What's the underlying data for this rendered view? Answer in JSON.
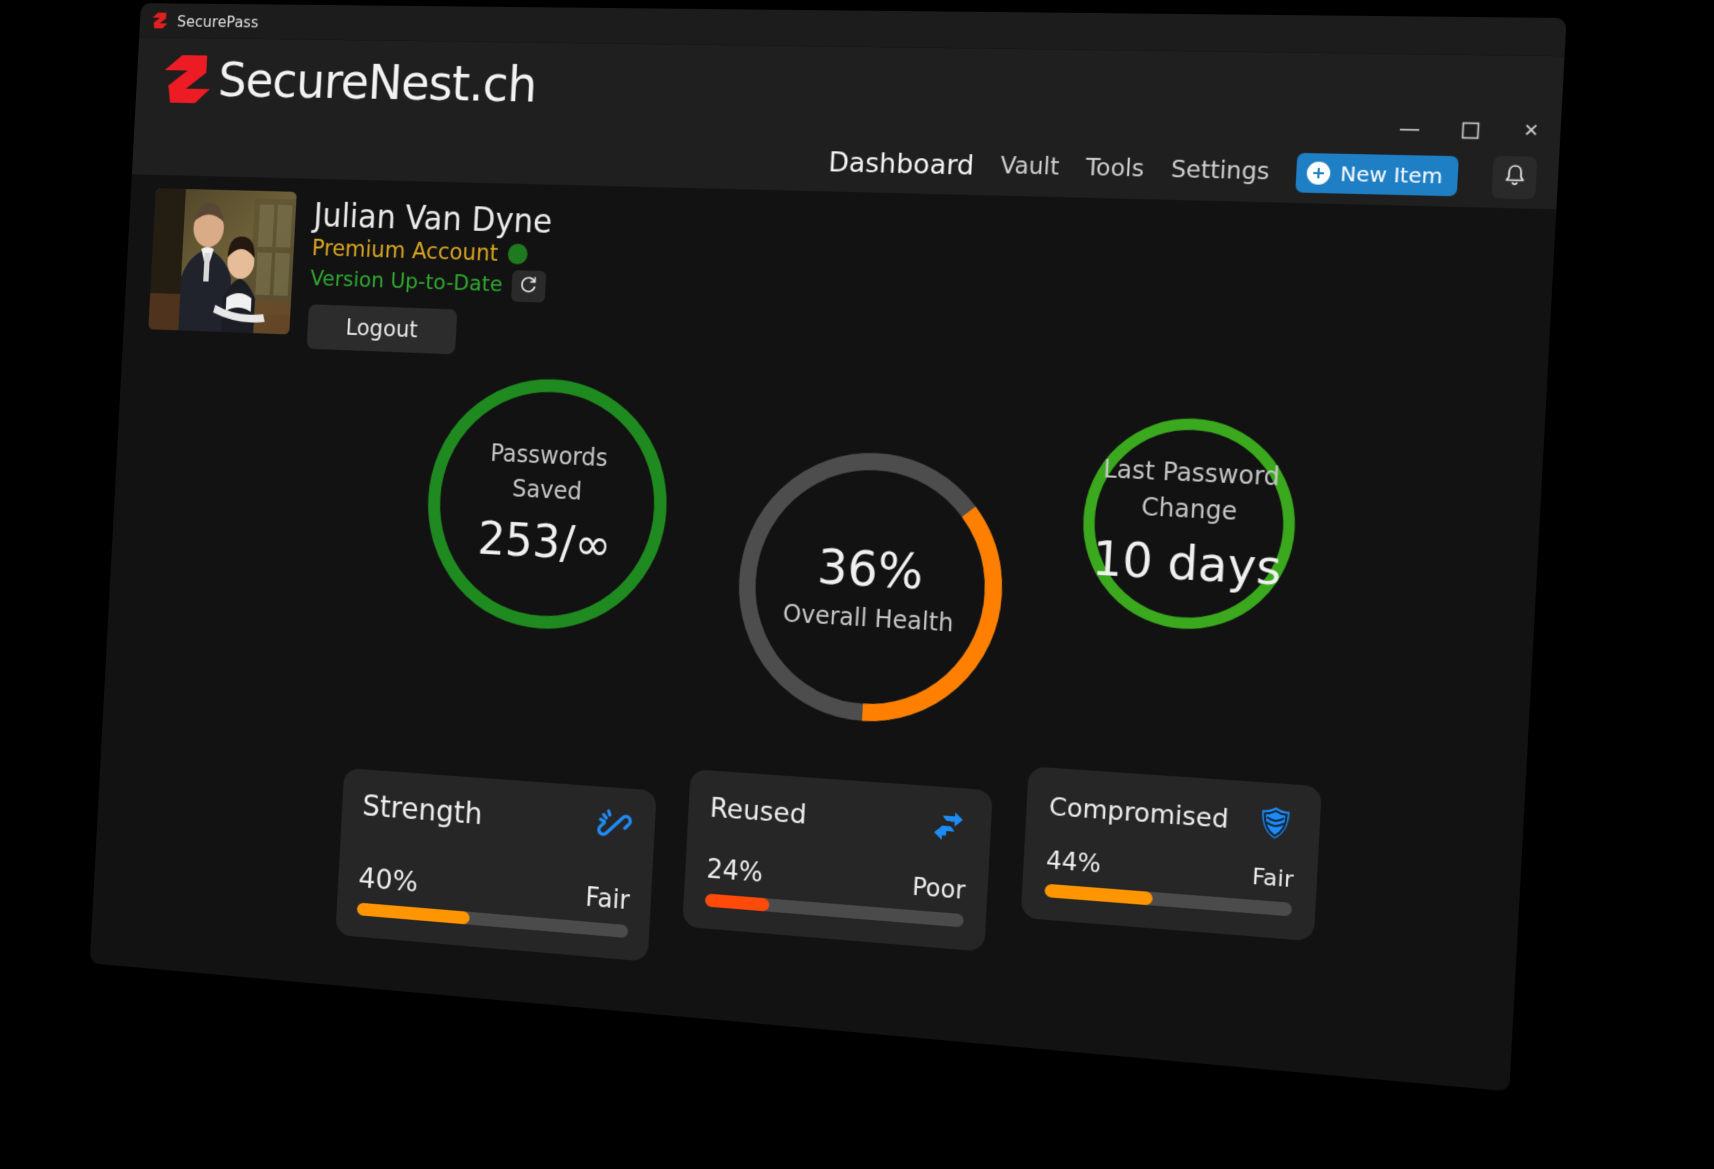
{
  "titlebar": {
    "app_name": "SecurePass",
    "logo_icon": "securepass-s-logo"
  },
  "brand": {
    "name": "SecureNest.ch",
    "logo_icon": "securenest-s-logo"
  },
  "window_controls": {
    "minimize": "minimize-icon",
    "maximize": "maximize-icon",
    "close": "close-icon",
    "close_glyph": "✕"
  },
  "nav": {
    "items": [
      {
        "label": "Dashboard",
        "active": true
      },
      {
        "label": "Vault",
        "active": false
      },
      {
        "label": "Tools",
        "active": false
      },
      {
        "label": "Settings",
        "active": false
      }
    ],
    "new_item_label": "New Item",
    "new_item_icon": "plus-circle-icon",
    "notifications_icon": "bell-icon"
  },
  "profile": {
    "avatar_icon": "user-photo-avatar",
    "name": "Julian Van Dyne",
    "tier": "Premium Account",
    "status_dot_icon": "status-dot-green",
    "version": "Version Up-to-Date",
    "refresh_icon": "refresh-icon",
    "logout_label": "Logout"
  },
  "rings": [
    {
      "key": "passwords-saved",
      "label_line1": "Passwords",
      "label_line2": "Saved",
      "value": "253/∞",
      "color": "#1f8a1f",
      "percent": 100
    },
    {
      "key": "overall-health",
      "value": "36%",
      "sub": "Overall Health",
      "color": "#FF8000",
      "track_color": "#4d4d4d",
      "percent": 36
    },
    {
      "key": "last-password-change",
      "label_line1": "Last Password",
      "label_line2": "Change",
      "value": "10 days",
      "color": "#3aa91e",
      "percent": 100
    }
  ],
  "cards": [
    {
      "key": "strength",
      "title": "Strength",
      "icon": "broken-link-icon",
      "percent_label": "40%",
      "rating": "Fair",
      "percent": 42,
      "bar_color": "#FF9500"
    },
    {
      "key": "reused",
      "title": "Reused",
      "icon": "repeat-arrows-icon",
      "percent_label": "24%",
      "rating": "Poor",
      "percent": 25,
      "bar_color": "#FF4A0A"
    },
    {
      "key": "compromised",
      "title": "Compromised",
      "icon": "shield-icon",
      "percent_label": "44%",
      "rating": "Fair",
      "percent": 44,
      "bar_color": "#FF9500"
    }
  ],
  "chart_data": {
    "type": "pie",
    "title": "Password Security Overview",
    "series": [
      {
        "name": "Overall Health",
        "value": 36,
        "unit": "%",
        "color": "#FF8000"
      },
      {
        "name": "Strength",
        "value": 40,
        "unit": "%",
        "rating": "Fair",
        "color": "#FF9500"
      },
      {
        "name": "Reused",
        "value": 24,
        "unit": "%",
        "rating": "Poor",
        "color": "#FF4A0A"
      },
      {
        "name": "Compromised",
        "value": 44,
        "unit": "%",
        "rating": "Fair",
        "color": "#FF9500"
      }
    ],
    "stats": [
      {
        "name": "Passwords Saved",
        "value": "253/∞"
      },
      {
        "name": "Last Password Change",
        "value": "10 days"
      }
    ],
    "ylim": [
      0,
      100
    ],
    "legend": "none",
    "grid": false
  }
}
